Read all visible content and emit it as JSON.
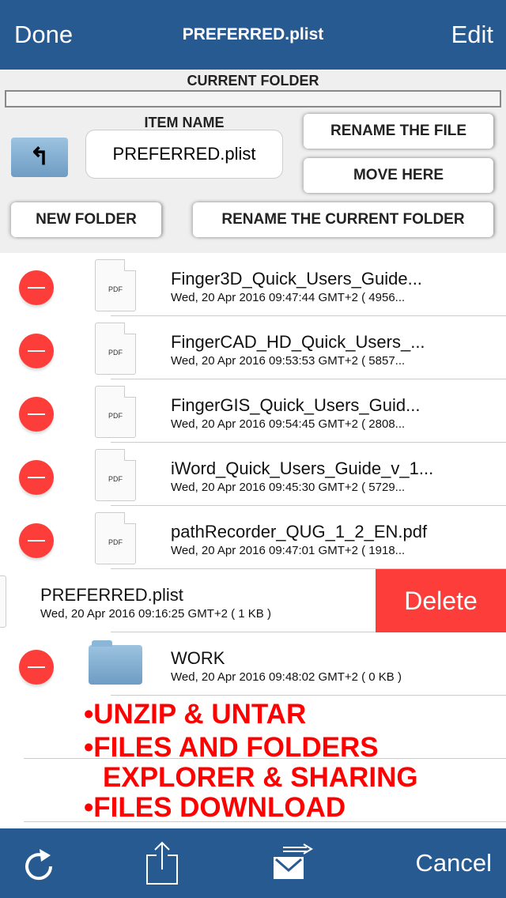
{
  "header": {
    "done": "Done",
    "title": "PREFERRED.plist",
    "edit": "Edit"
  },
  "panel": {
    "current_folder_label": "CURRENT FOLDER",
    "current_folder_value": "",
    "item_name_label": "ITEM NAME",
    "item_name_value": "PREFERRED.plist",
    "rename_file": "RENAME THE FILE",
    "move_here": "MOVE HERE",
    "new_folder": "NEW FOLDER",
    "rename_folder": "RENAME THE CURRENT FOLDER"
  },
  "files": [
    {
      "name": "Finger3D_Quick_Users_Guide...",
      "meta": "Wed, 20 Apr 2016 09:47:44 GMT+2 ( 4956...",
      "icon": "PDF"
    },
    {
      "name": "FingerCAD_HD_Quick_Users_...",
      "meta": "Wed, 20 Apr 2016 09:53:53 GMT+2 ( 5857...",
      "icon": "PDF"
    },
    {
      "name": "FingerGIS_Quick_Users_Guid...",
      "meta": "Wed, 20 Apr 2016 09:54:45 GMT+2 ( 2808...",
      "icon": "PDF"
    },
    {
      "name": "iWord_Quick_Users_Guide_v_1...",
      "meta": "Wed, 20 Apr 2016 09:45:30 GMT+2 ( 5729...",
      "icon": "PDF"
    },
    {
      "name": "pathRecorder_QUG_1_2_EN.pdf",
      "meta": "Wed, 20 Apr 2016 09:47:01 GMT+2 ( 1918...",
      "icon": "PDF"
    }
  ],
  "swiped": {
    "name": "PREFERRED.plist",
    "meta": "Wed, 20 Apr 2016 09:16:25 GMT+2 ( 1 KB )",
    "delete": "Delete"
  },
  "folder": {
    "name": "WORK",
    "meta": "Wed, 20 Apr 2016 09:48:02 GMT+2 ( 0 KB )"
  },
  "promo": [
    "•UNZIP & UNTAR",
    "•FILES AND FOLDERS",
    "EXPLORER & SHARING",
    "•FILES DOWNLOAD"
  ],
  "footer": {
    "cancel": "Cancel"
  },
  "colors": {
    "bar": "#285a92",
    "delete": "#fc3d39",
    "promo": "#ff0000"
  }
}
